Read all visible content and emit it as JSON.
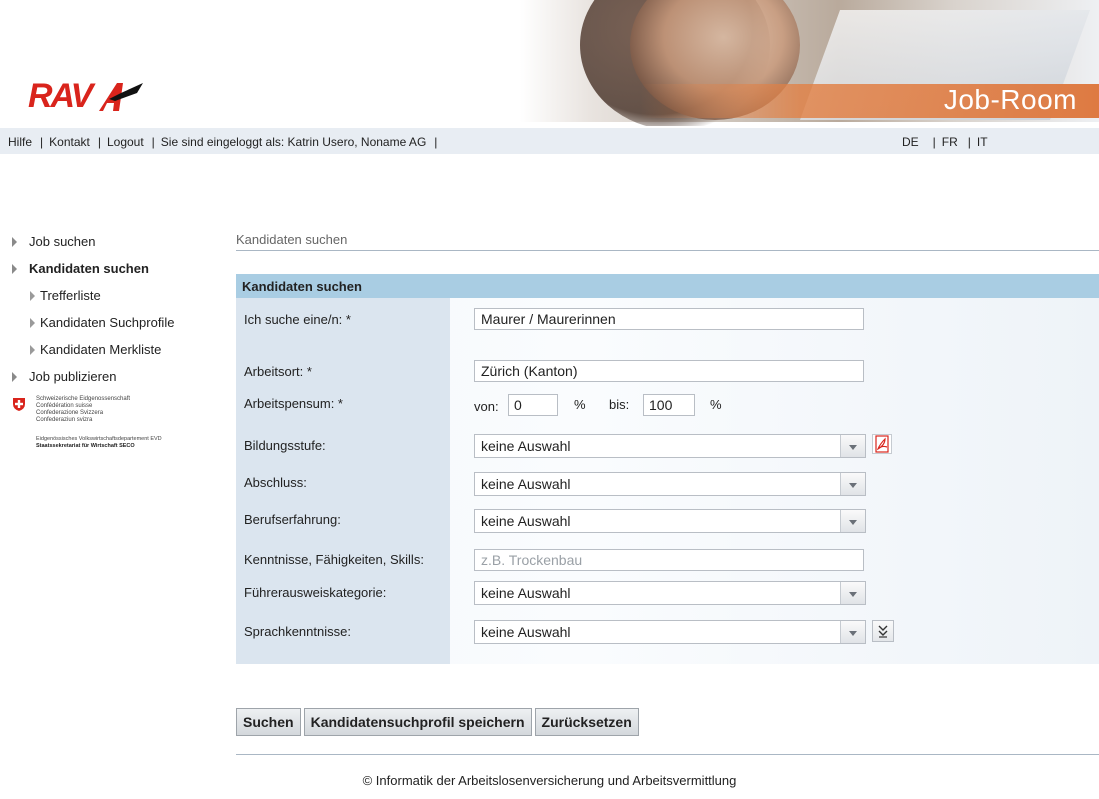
{
  "header": {
    "logo_text": "RAV",
    "brand_title": "Job-Room"
  },
  "topnav": {
    "left": [
      "Hilfe",
      "Kontakt",
      "Logout",
      "Sie sind eingeloggt als: Katrin Usero, Noname AG"
    ],
    "languages": [
      "DE",
      "FR",
      "IT"
    ]
  },
  "sidebar": {
    "items": [
      {
        "label": "Job suchen"
      },
      {
        "label": "Kandidaten suchen"
      },
      {
        "label": "Trefferliste"
      },
      {
        "label": "Kandidaten Suchprofile"
      },
      {
        "label": "Kandidaten Merkliste"
      },
      {
        "label": "Job publizieren"
      }
    ],
    "confederation": [
      "Schweizerische Eidgenossenschaft",
      "Confédération suisse",
      "Confederazione Svizzera",
      "Confederaziun svizra"
    ],
    "department": "Eidgenössisches Volkswirtschaftsdepartement EVD",
    "seco": "Staatssekretariat für Wirtschaft SECO"
  },
  "breadcrumb": "Kandidaten suchen",
  "panel": {
    "title": "Kandidaten suchen",
    "fields": {
      "beruf": {
        "label": "Ich suche eine/n: *",
        "value": "Maurer / Maurerinnen"
      },
      "arbeitsort": {
        "label": "Arbeitsort: *",
        "value": "Zürich (Kanton)"
      },
      "pensum": {
        "label": "Arbeitspensum: *",
        "von_label": "von:",
        "von_value": "0",
        "unit1": "%",
        "bis_label": "bis:",
        "bis_value": "100",
        "unit2": "%"
      },
      "bildung": {
        "label": "Bildungsstufe:",
        "value": "keine Auswahl"
      },
      "abschluss": {
        "label": "Abschluss:",
        "value": "keine Auswahl"
      },
      "erfahrung": {
        "label": "Berufserfahrung:",
        "value": "keine Auswahl"
      },
      "skills": {
        "label": "Kenntnisse, Fähigkeiten, Skills:",
        "placeholder": "z.B. Trockenbau"
      },
      "fuehrerausweis": {
        "label": "Führerausweiskategorie:",
        "value": "keine Auswahl"
      },
      "sprache": {
        "label": "Sprachkenntnisse:",
        "value": "keine Auswahl"
      }
    }
  },
  "buttons": {
    "search": "Suchen",
    "save_profile": "Kandidatensuchprofil speichern",
    "reset": "Zurücksetzen"
  },
  "footer": "© Informatik der Arbeitslosenversicherung und Arbeitsvermittlung",
  "colors": {
    "accent_red": "#d9241c",
    "header_orange": "#de7a42",
    "panel_header": "#a9cde3"
  }
}
